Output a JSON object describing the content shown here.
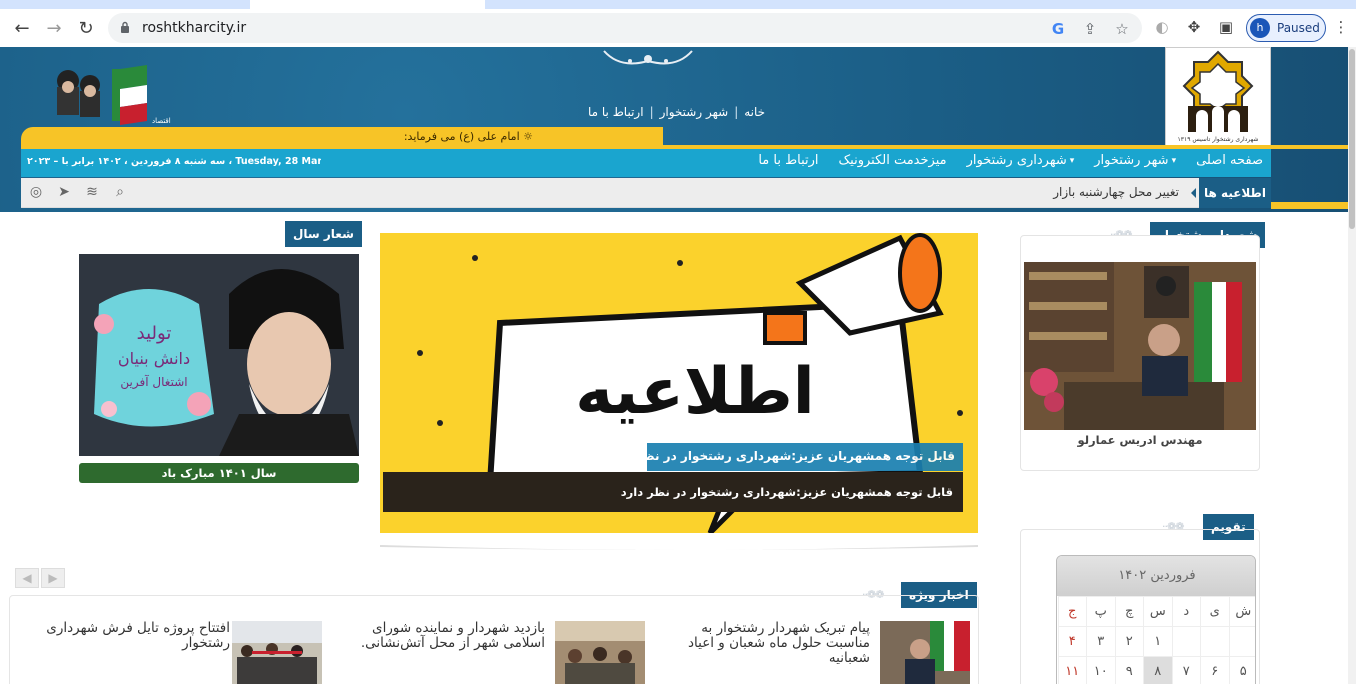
{
  "browser": {
    "url": "roshtkharcity.ir",
    "profile_initial": "h",
    "profile_status": "Paused"
  },
  "header": {
    "top_links": [
      "خانه",
      "شهر رشتخوار",
      "ارتباط با ما"
    ],
    "quote": "امام علی (ع) می فرماید:",
    "date_text": "سه شنبه ۸ فروردین ، ۱۴۰۲ برابر با – ۲۰۲۳ ، Tuesday, 28 March",
    "logo_caption": "شهرداری رشتخوار تاسیس ۱۳۱۹"
  },
  "nav": {
    "items": [
      {
        "label": "صفحه اصلی",
        "caret": false
      },
      {
        "label": "شهر رشتخوار",
        "caret": true
      },
      {
        "label": "شهرداری رشتخوار",
        "caret": true
      },
      {
        "label": "میزخدمت الکترونیک",
        "caret": false
      },
      {
        "label": "ارتباط با ما",
        "caret": false
      }
    ]
  },
  "ticker": {
    "label": "اطلاعیه ها",
    "text": "تغییر محل چهارشنبه بازار"
  },
  "mayor": {
    "section_title": "شهردار رشتخوار",
    "name": "مهندس ادریس عمارلو"
  },
  "slider": {
    "banner_word": "اطلاعیه",
    "caption_title": "قابل توجه همشهریان عزیز:شهرداری رشتخوار در نظر دارد",
    "caption_text": "قابل توجه همشهریان عزیز:شهرداری رشتخوار در نظر دارد"
  },
  "motto": {
    "section_title": "شعار سال",
    "poster_text": [
      "تولید",
      "دانش بنیان",
      "اشتغال آفرین"
    ],
    "caption": "سال ۱۴۰۱ مبارک باد"
  },
  "news": {
    "section_title": "اخبار ویژه",
    "items": [
      {
        "title": "پیام تبریک شهردار رشتخوار به مناسبت حلول ماه شعبان و اعیاد شعبانیه"
      },
      {
        "title": "بازدید شهردار و نماینده شورای اسلامی شهر از محل آتش‌نشانی."
      },
      {
        "title": "افتتاح پروژه تایل فرش شهرداری رشتخوار"
      }
    ]
  },
  "calendar": {
    "section_title": "تقویم",
    "month": "فروردین ۱۴۰۲",
    "weekdays": [
      "ش",
      "ی",
      "د",
      "س",
      "چ",
      "پ",
      "ج"
    ],
    "week1": [
      "",
      "",
      "",
      "",
      "۱",
      "۲",
      "۳",
      "۴"
    ],
    "row1": [
      "",
      "",
      "",
      "۱",
      "۲",
      "۳",
      "۴"
    ],
    "row2": [
      "۵",
      "۶",
      "۷",
      "۸",
      "۹",
      "۱۰",
      "۱۱"
    ]
  },
  "colors": {
    "header_blue": "#1b5e86",
    "nav_cyan": "#1aa5cf",
    "gold": "#f7c427",
    "banner_yellow": "#fbd22c"
  }
}
